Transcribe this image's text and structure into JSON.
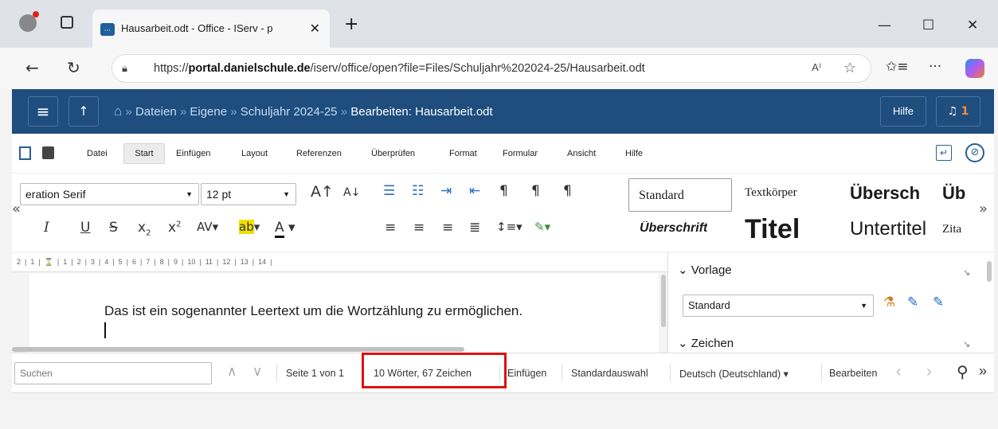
{
  "browser": {
    "tab_title": "Hausarbeit.odt - Office - IServ - p",
    "tab_close": "✕",
    "new_tab": "+",
    "win_minimize": "—",
    "win_maximize": "☐",
    "win_close": "✕",
    "url_prefix": "https://",
    "url_host": "portal.danielschule.de",
    "url_path": "/iserv/office/open?file=Files/Schuljahr%202024-25/Hausarbeit.odt",
    "read_aloud": "A⁾",
    "menu_dots": "···"
  },
  "app": {
    "menu_icon": "≡",
    "up_icon": "↑",
    "breadcrumb": {
      "home": "⌂",
      "sep": " » ",
      "files": "Dateien",
      "own": "Eigene",
      "year": "Schuljahr 2024-25",
      "current": "Bearbeiten: Hausarbeit.odt"
    },
    "help": "Hilfe",
    "notif_icon": "🔔",
    "notif_count": "1"
  },
  "menubar": {
    "file": "Datei",
    "start": "Start",
    "insert": "Einfügen",
    "layout": "Layout",
    "references": "Referenzen",
    "review": "Überprüfen",
    "format": "Format",
    "form": "Formular",
    "view": "Ansicht",
    "help": "Hilfe"
  },
  "ribbon": {
    "font_name": "eration Serif",
    "font_size": "12 pt",
    "collapse_left": "«",
    "collapse_right": "»",
    "styles": {
      "standard": "Standard",
      "textbody": "Textkörper",
      "heading_big": "Übersch",
      "heading_ub": "Üb",
      "heading_italic": "Überschrift",
      "title": "Titel",
      "subtitle": "Untertitel",
      "quote": "Zita"
    }
  },
  "ruler": {
    "ticks": "2  |  1  |  ⌛  |  1  |  2  |  3  |  4  |  5  |  6  |  7  |  8  |  9  |  10  |  11  |  12  |  13  |  14  |"
  },
  "document": {
    "text": "Das ist ein sogenannter Leertext um die Wortzählung zu ermöglichen."
  },
  "sidebar": {
    "section1": "Vorlage",
    "style_value": "Standard",
    "section2": "Zeichen"
  },
  "statusbar": {
    "search_placeholder": "Suchen",
    "page": "Seite 1 von 1",
    "word_count": "10 Wörter, 67 Zeichen",
    "insert_mode": "Einfügen",
    "selection_mode": "Standardauswahl",
    "language": "Deutsch (Deutschland) ▾",
    "edit": "Bearbeiten"
  },
  "colors": {
    "header": "#1e4d7e",
    "highlight": "#e01010"
  }
}
